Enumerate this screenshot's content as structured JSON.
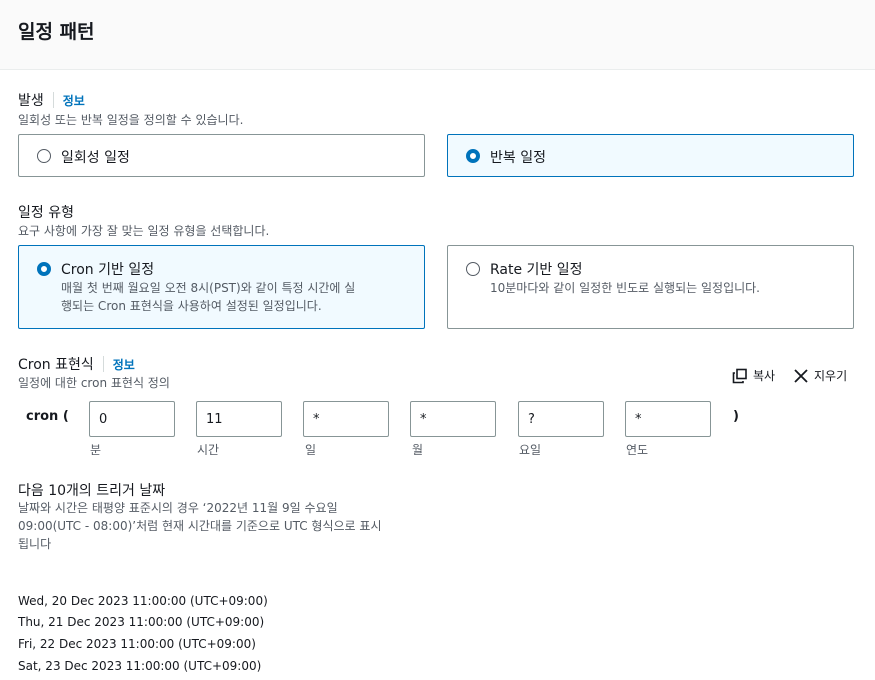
{
  "header": {
    "title": "일정 패턴"
  },
  "occurrence": {
    "label": "발생",
    "info": "정보",
    "description": "일회성 또는 반복 일정을 정의할 수 있습니다.",
    "options": [
      {
        "label": "일회성 일정",
        "selected": false
      },
      {
        "label": "반복 일정",
        "selected": true
      }
    ]
  },
  "schedule_type": {
    "label": "일정 유형",
    "description": "요구 사항에 가장 잘 맞는 일정 유형을 선택합니다.",
    "options": [
      {
        "label": "Cron 기반 일정",
        "desc_line1": "매월 첫 번째 월요일 오전 8시(PST)와 같이 특정 시간에 실",
        "desc_line2": "행되는 Cron 표현식을 사용하여 설정된 일정입니다.",
        "selected": true
      },
      {
        "label": "Rate 기반 일정",
        "desc_line1": "10분마다와 같이 일정한 빈도로 실행되는 일정입니다.",
        "selected": false
      }
    ]
  },
  "cron": {
    "label": "Cron 표현식",
    "info": "정보",
    "description": "일정에 대한 cron 표현식 정의",
    "copy_label": "복사",
    "clear_label": "지우기",
    "prefix": "cron (",
    "suffix": ")",
    "fields": [
      {
        "value": "0",
        "label": "분"
      },
      {
        "value": "11",
        "label": "시간"
      },
      {
        "value": "*",
        "label": "일"
      },
      {
        "value": "*",
        "label": "월"
      },
      {
        "value": "?",
        "label": "요일"
      },
      {
        "value": "*",
        "label": "연도"
      }
    ]
  },
  "next_triggers": {
    "title": "다음 10개의 트리거 날짜",
    "desc_line1": "날짜와 시간은 태평양 표준시의 경우 ‘2022년 11월 9일 수요일",
    "desc_line2": "09:00(UTC - 08:00)’처럼 현재 시간대를 기준으로 UTC 형식으로 표시",
    "desc_line3": "됩니다",
    "dates": [
      "Wed, 20 Dec 2023 11:00:00 (UTC+09:00)",
      "Thu, 21 Dec 2023 11:00:00 (UTC+09:00)",
      "Fri, 22 Dec 2023 11:00:00 (UTC+09:00)",
      "Sat, 23 Dec 2023 11:00:00 (UTC+09:00)"
    ]
  }
}
